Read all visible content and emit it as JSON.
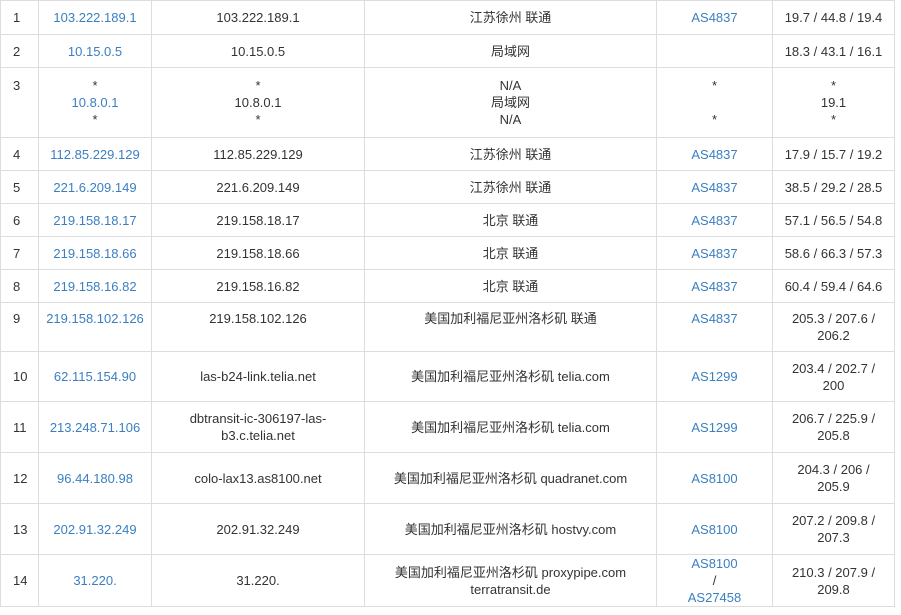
{
  "rows": [
    {
      "hop": "1",
      "ip": "103.222.189.1",
      "host": "103.222.189.1",
      "location": [
        "江苏徐州 联通"
      ],
      "asn": [
        "AS4837"
      ],
      "latency": [
        "19.7 / 44.8 / 19.4"
      ]
    },
    {
      "hop": "2",
      "ip": "10.15.0.5",
      "host": "10.15.0.5",
      "location": [
        "局域网"
      ],
      "asn": [],
      "latency": [
        "18.3 / 43.1 / 16.1"
      ]
    },
    {
      "hop": "3",
      "ip_lines": [
        "*",
        "10.8.0.1",
        "*"
      ],
      "host_lines": [
        "*",
        "10.8.0.1",
        "*"
      ],
      "location": [
        "N/A",
        "局域网",
        "N/A"
      ],
      "asn_lines": [
        "*",
        "",
        "*"
      ],
      "latency": [
        "*",
        "19.1",
        "*"
      ]
    },
    {
      "hop": "4",
      "ip": "112.85.229.129",
      "host": "112.85.229.129",
      "location": [
        "江苏徐州 联通"
      ],
      "asn": [
        "AS4837"
      ],
      "latency": [
        "17.9 / 15.7 / 19.2"
      ]
    },
    {
      "hop": "5",
      "ip": "221.6.209.149",
      "host": "221.6.209.149",
      "location": [
        "江苏徐州 联通"
      ],
      "asn": [
        "AS4837"
      ],
      "latency": [
        "38.5 / 29.2 / 28.5"
      ]
    },
    {
      "hop": "6",
      "ip": "219.158.18.17",
      "host": "219.158.18.17",
      "location": [
        "北京 联通"
      ],
      "asn": [
        "AS4837"
      ],
      "latency": [
        "57.1 / 56.5 / 54.8"
      ]
    },
    {
      "hop": "7",
      "ip": "219.158.18.66",
      "host": "219.158.18.66",
      "location": [
        "北京 联通"
      ],
      "asn": [
        "AS4837"
      ],
      "latency": [
        "58.6 / 66.3 / 57.3"
      ]
    },
    {
      "hop": "8",
      "ip": "219.158.16.82",
      "host": "219.158.16.82",
      "location": [
        "北京 联通"
      ],
      "asn": [
        "AS4837"
      ],
      "latency": [
        "60.4 / 59.4 / 64.6"
      ]
    },
    {
      "hop": "9",
      "ip": "219.158.102.126",
      "host": "219.158.102.126",
      "location": [
        "美国加利福尼亚州洛杉矶 联通"
      ],
      "asn": [
        "AS4837"
      ],
      "latency": [
        "205.3 / 207.6 /",
        "206.2"
      ]
    },
    {
      "hop": "10",
      "ip": "62.115.154.90",
      "host": "las-b24-link.telia.net",
      "location": [
        "美国加利福尼亚州洛杉矶 telia.com"
      ],
      "asn": [
        "AS1299"
      ],
      "latency": [
        "203.4 / 202.7 /",
        "200"
      ]
    },
    {
      "hop": "11",
      "ip": "213.248.71.106",
      "host_lines": [
        "dbtransit-ic-306197-las-",
        "b3.c.telia.net"
      ],
      "location": [
        "美国加利福尼亚州洛杉矶 telia.com"
      ],
      "asn": [
        "AS1299"
      ],
      "latency": [
        "206.7 / 225.9 /",
        "205.8"
      ]
    },
    {
      "hop": "12",
      "ip": "96.44.180.98",
      "host": "colo-lax13.as8100.net",
      "location": [
        "美国加利福尼亚州洛杉矶 quadranet.com"
      ],
      "asn": [
        "AS8100"
      ],
      "latency": [
        "204.3 / 206 /",
        "205.9"
      ]
    },
    {
      "hop": "13",
      "ip": "202.91.32.249",
      "host": "202.91.32.249",
      "location": [
        "美国加利福尼亚州洛杉矶 hostvy.com"
      ],
      "asn": [
        "AS8100"
      ],
      "latency": [
        "207.2 / 209.8 /",
        "207.3"
      ]
    },
    {
      "hop": "14",
      "ip": "31.220.",
      "host": "31.220.",
      "location": [
        "美国加利福尼亚州洛杉矶 proxypipe.com",
        "terratransit.de"
      ],
      "asn_pair": [
        "AS8100",
        " /",
        "AS27458"
      ],
      "latency": [
        "210.3 / 207.9 /",
        "209.8"
      ]
    }
  ],
  "colors": {
    "link": "#3a7fc1",
    "border": "#dddddd",
    "text": "#333333"
  }
}
